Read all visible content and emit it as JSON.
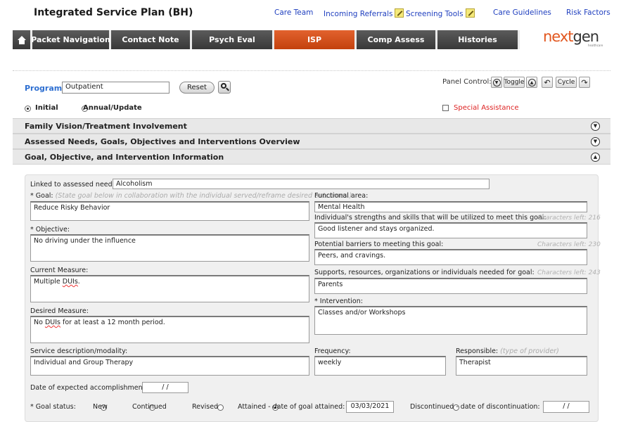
{
  "header": {
    "title": "Integrated Service Plan (BH)",
    "links": [
      "Care Team",
      "Incoming Referrals",
      "Screening Tools",
      "Care Guidelines",
      "Risk Factors"
    ]
  },
  "nav": {
    "tabs": [
      "Packet Navigation",
      "Contact Note",
      "Psych Eval",
      "ISP",
      "Comp Assess",
      "Histories"
    ],
    "active": "ISP",
    "logo": {
      "next": "next",
      "gen": "gen",
      "sub": "healthcare"
    }
  },
  "program": {
    "label": "Program:",
    "value": "Outpatient",
    "reset_label": "Reset"
  },
  "panel_control": {
    "label": "Panel Control:",
    "toggle_label": "Toggle",
    "cycle_label": "Cycle"
  },
  "plan_type": {
    "options": [
      "Initial",
      "Annual/Update"
    ],
    "selected": "Initial"
  },
  "special_assistance": {
    "label": "Special Assistance",
    "checked": false
  },
  "sections": [
    {
      "title": "Family Vision/Treatment Involvement",
      "state": "collapsed"
    },
    {
      "title": "Assessed Needs, Goals, Objectives and Interventions Overview",
      "state": "collapsed"
    },
    {
      "title": "Goal, Objective, and Intervention Information",
      "state": "expanded"
    }
  ],
  "form": {
    "linked_label": "Linked to assessed need:",
    "linked_value": "Alcoholism",
    "goal_label": "* Goal:",
    "goal_hint": "(State goal below in collaboration with the individual served/reframe desired outcomes.)",
    "goal_value": "Reduce Risky Behavior",
    "objective_label": "* Objective:",
    "objective_value": "No driving under the influence",
    "current_measure_label": "Current Measure:",
    "current_measure_pre": "Multiple ",
    "current_measure_err": "DUIs",
    "current_measure_post": ".",
    "desired_measure_label": "Desired Measure:",
    "desired_measure_pre": "No ",
    "desired_measure_err": "DUIs",
    "desired_measure_post": " for at least a 12 month period.",
    "service_label": "Service description/modality:",
    "service_value": "Individual and Group Therapy",
    "functional_area_label": "Functional area:",
    "functional_area_value": "Mental Health",
    "strengths_label": "Individual's strengths and skills that will be utilized to meet this goal:",
    "strengths_chars": "Characters left: 216",
    "strengths_value": "Good listener and stays organized.",
    "barriers_label": "Potential barriers to meeting this goal:",
    "barriers_chars": "Characters left: 230",
    "barriers_value": "Peers, and cravings.",
    "supports_label": "Supports, resources, organizations or individuals needed for goal:",
    "supports_chars": "Characters left: 243",
    "supports_value": "Parents",
    "intervention_label": "* Intervention:",
    "intervention_value": "Classes and/or Workshops",
    "frequency_label": "Frequency:",
    "frequency_value": "weekly",
    "responsible_label": "Responsible:",
    "responsible_hint": "(type of provider)",
    "responsible_value": "Therapist",
    "expected_date_label": "Date of expected accomplishment:",
    "expected_date_value": "/ /",
    "goal_status_label": "* Goal status:",
    "status_options": {
      "new": "New",
      "continued": "Continued",
      "revised": "Revised",
      "attained": "Attained - date of goal attained:",
      "discontinued": "Discontinued - date of discontinuation:"
    },
    "status_selected": "Attained",
    "attained_date": "03/03/2021",
    "discontinued_date": "/ /"
  }
}
